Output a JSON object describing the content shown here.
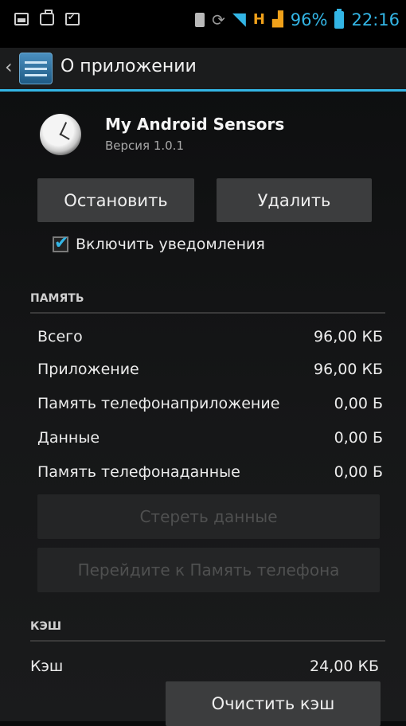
{
  "status_bar": {
    "battery_percent": "96%",
    "time": "22:16",
    "network": "H",
    "left_icons": [
      "gallery-icon",
      "briefcase-icon",
      "check-notification-icon"
    ],
    "right_icons": [
      "sd-card-icon",
      "sync-icon",
      "wifi-icon",
      "network-h-icon",
      "signal-icon",
      "battery-icon"
    ]
  },
  "action_bar": {
    "title": "О приложении"
  },
  "app": {
    "name": "My Android Sensors",
    "version": "Версия 1.0.1"
  },
  "buttons": {
    "stop": "Остановить",
    "uninstall": "Удалить",
    "clear_data": "Стереть данные",
    "move_to_phone": "Перейдите к Память телефона",
    "clear_cache": "Очистить кэш"
  },
  "notifications": {
    "label": "Включить уведомления",
    "checked": true
  },
  "storage": {
    "header": "ПАМЯТЬ",
    "rows": [
      {
        "label": "Всего",
        "value": "96,00 КБ"
      },
      {
        "label": "Приложение",
        "value": "96,00 КБ"
      },
      {
        "label": "Память телефонаприложение",
        "value": "0,00 Б"
      },
      {
        "label": "Данные",
        "value": "0,00 Б"
      },
      {
        "label": "Память телефонаданные",
        "value": "0,00 Б"
      }
    ]
  },
  "cache": {
    "header": "КЭШ",
    "label": "Кэш",
    "value": "24,00 КБ"
  },
  "colors": {
    "accent": "#33b5e5",
    "button": "#3c3d3e",
    "button_disabled": "#242526",
    "status_orange": "#f0a11a"
  }
}
